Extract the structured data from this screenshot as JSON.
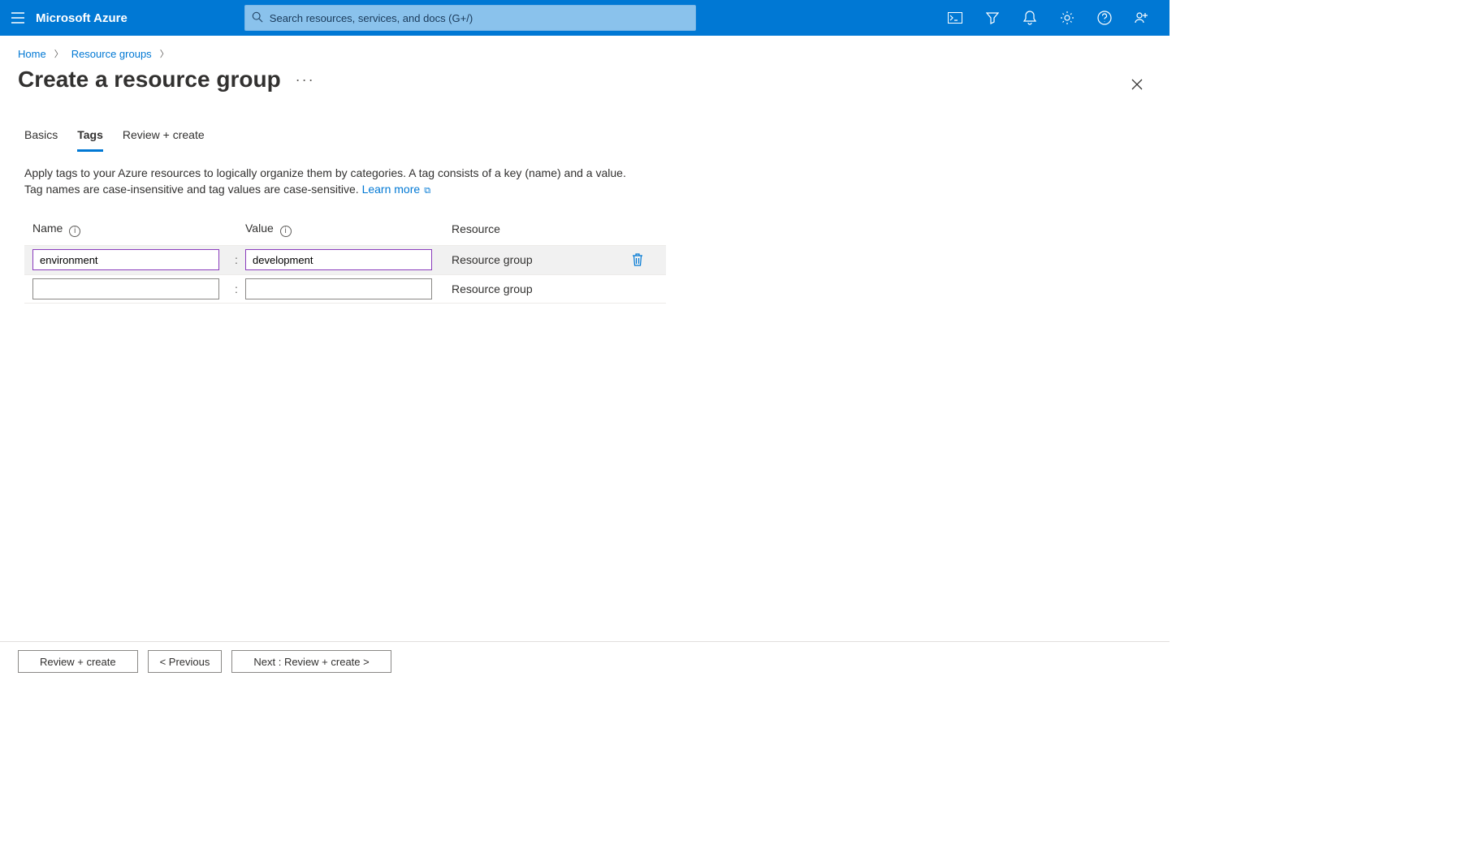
{
  "header": {
    "brand": "Microsoft Azure",
    "search_placeholder": "Search resources, services, and docs (G+/)"
  },
  "breadcrumb": {
    "items": [
      "Home",
      "Resource groups"
    ]
  },
  "page": {
    "title": "Create a resource group"
  },
  "tabs": {
    "items": [
      "Basics",
      "Tags",
      "Review + create"
    ],
    "active_index": 1
  },
  "description": {
    "line1": "Apply tags to your Azure resources to logically organize them by categories. A tag consists of a key (name) and a value.",
    "line2_prefix": "Tag names are case-insensitive and tag values are case-sensitive. ",
    "learn_more": "Learn more"
  },
  "tag_table": {
    "headers": {
      "name": "Name",
      "value": "Value",
      "resource": "Resource"
    },
    "rows": [
      {
        "name": "environment",
        "value": "development",
        "resource": "Resource group",
        "deletable": true
      },
      {
        "name": "",
        "value": "",
        "resource": "Resource group",
        "deletable": false
      }
    ]
  },
  "footer": {
    "review_create": "Review + create",
    "previous": "< Previous",
    "next": "Next : Review + create >"
  }
}
